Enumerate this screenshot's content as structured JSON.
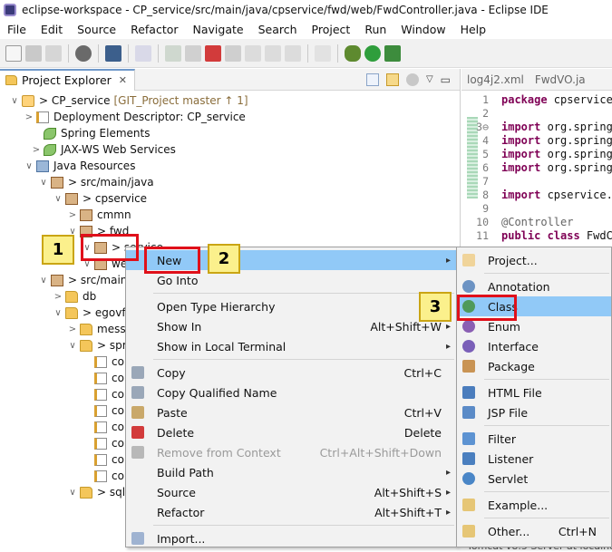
{
  "window": {
    "title": "eclipse-workspace - CP_service/src/main/java/cpservice/fwd/web/FwdController.java - Eclipse IDE"
  },
  "menubar": [
    "File",
    "Edit",
    "Source",
    "Refactor",
    "Navigate",
    "Search",
    "Project",
    "Run",
    "Window",
    "Help"
  ],
  "project_explorer": {
    "tab_label": "Project Explorer",
    "tab_close": "✕",
    "tree": [
      {
        "label": "> CP_service",
        "git": "[GIT_Project master ↑ 1]",
        "icon": "project",
        "twisty": "∨"
      },
      {
        "label": "Deployment Descriptor: CP_service",
        "icon": "xml",
        "twisty": ">"
      },
      {
        "label": "Spring Elements",
        "icon": "spring",
        "twisty": ""
      },
      {
        "label": "JAX-WS Web Services",
        "icon": "spring",
        "twisty": ">"
      },
      {
        "label": "Java Resources",
        "icon": "jar",
        "twisty": "∨"
      },
      {
        "label": "> src/main/java",
        "icon": "pkg",
        "twisty": "∨"
      },
      {
        "label": "> cpservice",
        "icon": "pkg",
        "twisty": "∨"
      },
      {
        "label": "cmmn",
        "icon": "pkg",
        "twisty": ">"
      },
      {
        "label": "> fwd",
        "icon": "pkg",
        "twisty": "∨"
      },
      {
        "label": "> service",
        "icon": "pkg",
        "twisty": "∨"
      },
      {
        "label": "we",
        "icon": "pkg",
        "twisty": "∨"
      },
      {
        "label": "> src/main/",
        "icon": "pkg",
        "twisty": "∨"
      },
      {
        "label": "db",
        "icon": "folder",
        "twisty": ">"
      },
      {
        "label": "> egovfr",
        "icon": "folder",
        "twisty": "∨"
      },
      {
        "label": "messa",
        "icon": "folder",
        "twisty": ">"
      },
      {
        "label": "> spri",
        "icon": "folder",
        "twisty": "∨"
      },
      {
        "label": "co",
        "icon": "xml",
        "twisty": ""
      },
      {
        "label": "co",
        "icon": "xml",
        "twisty": ""
      },
      {
        "label": "co",
        "icon": "xml",
        "twisty": ""
      },
      {
        "label": "co",
        "icon": "xml",
        "twisty": ""
      },
      {
        "label": "co",
        "icon": "xml",
        "twisty": ""
      },
      {
        "label": "co",
        "icon": "xml",
        "twisty": ""
      },
      {
        "label": "co",
        "icon": "xml",
        "twisty": ""
      },
      {
        "label": "co",
        "icon": "xml",
        "twisty": ""
      },
      {
        "label": "> sqlm",
        "icon": "folder",
        "twisty": "∨"
      }
    ]
  },
  "editor": {
    "tabs": [
      "log4j2.xml",
      "FwdVO.ja"
    ],
    "line_numbers": [
      "1",
      "2",
      "3⊖",
      "4",
      "5",
      "6",
      "7",
      "8",
      "9",
      "10",
      "11"
    ],
    "lines": [
      {
        "kw": "package",
        "rest": " cpservice"
      },
      {
        "kw": "",
        "rest": ""
      },
      {
        "kw": "import",
        "rest": " org.springf"
      },
      {
        "kw": "import",
        "rest": " org.springf"
      },
      {
        "kw": "import",
        "rest": " org.springf"
      },
      {
        "kw": "import",
        "rest": " org.springf"
      },
      {
        "kw": "",
        "rest": ""
      },
      {
        "kw": "import",
        "rest": " cpservice.f"
      },
      {
        "kw": "",
        "rest": ""
      },
      {
        "ann": "@Controller"
      },
      {
        "kw": "public class",
        "rest": " FwdCo"
      }
    ],
    "status_fragment": "Tomcat v8.5 Server at localho"
  },
  "context_menu": {
    "items": [
      {
        "label": "New",
        "key": "",
        "arrow": true,
        "selected": true,
        "icon": ""
      },
      {
        "label": "Go Into",
        "key": "",
        "arrow": false,
        "icon": ""
      },
      {
        "sep": true
      },
      {
        "label": "Open Type Hierarchy",
        "key": "",
        "arrow": false,
        "icon": ""
      },
      {
        "label": "Show In",
        "key": "Alt+Shift+W",
        "arrow": true,
        "icon": ""
      },
      {
        "label": "Show in Local Terminal",
        "key": "",
        "arrow": true,
        "icon": ""
      },
      {
        "sep": true
      },
      {
        "label": "Copy",
        "key": "Ctrl+C",
        "arrow": false,
        "icon": "copy"
      },
      {
        "label": "Copy Qualified Name",
        "key": "",
        "arrow": false,
        "icon": "copy"
      },
      {
        "label": "Paste",
        "key": "Ctrl+V",
        "arrow": false,
        "icon": "paste"
      },
      {
        "label": "Delete",
        "key": "Delete",
        "arrow": false,
        "icon": "delete"
      },
      {
        "label": "Remove from Context",
        "key": "Ctrl+Alt+Shift+Down",
        "arrow": false,
        "disabled": true,
        "icon": "remove"
      },
      {
        "label": "Build Path",
        "key": "",
        "arrow": true,
        "icon": ""
      },
      {
        "label": "Source",
        "key": "Alt+Shift+S",
        "arrow": true,
        "icon": ""
      },
      {
        "label": "Refactor",
        "key": "Alt+Shift+T",
        "arrow": true,
        "icon": ""
      },
      {
        "sep": true
      },
      {
        "label": "Import...",
        "key": "",
        "arrow": false,
        "icon": "import"
      }
    ]
  },
  "submenu": {
    "items": [
      {
        "label": "Project...",
        "key": "",
        "icon": "project"
      },
      {
        "sep": true
      },
      {
        "label": "Annotation",
        "key": "",
        "icon": "annotation"
      },
      {
        "label": "Class",
        "key": "",
        "icon": "class",
        "selected": true
      },
      {
        "label": "Enum",
        "key": "",
        "icon": "enum"
      },
      {
        "label": "Interface",
        "key": "",
        "icon": "interface"
      },
      {
        "label": "Package",
        "key": "",
        "icon": "package"
      },
      {
        "sep": true
      },
      {
        "label": "HTML File",
        "key": "",
        "icon": "html"
      },
      {
        "label": "JSP File",
        "key": "",
        "icon": "jsp"
      },
      {
        "sep": true
      },
      {
        "label": "Filter",
        "key": "",
        "icon": "filter"
      },
      {
        "label": "Listener",
        "key": "",
        "icon": "listener"
      },
      {
        "label": "Servlet",
        "key": "",
        "icon": "servlet"
      },
      {
        "sep": true
      },
      {
        "label": "Example...",
        "key": "",
        "icon": "example"
      },
      {
        "sep": true
      },
      {
        "label": "Other...",
        "key": "Ctrl+N",
        "icon": "other"
      }
    ]
  },
  "callouts": [
    "1",
    "2",
    "3"
  ],
  "colors": {
    "selection": "#91c9f7",
    "callout_fill": "#fbf08c",
    "highlight_box": "#e0101a",
    "keyword": "#7f0055"
  }
}
